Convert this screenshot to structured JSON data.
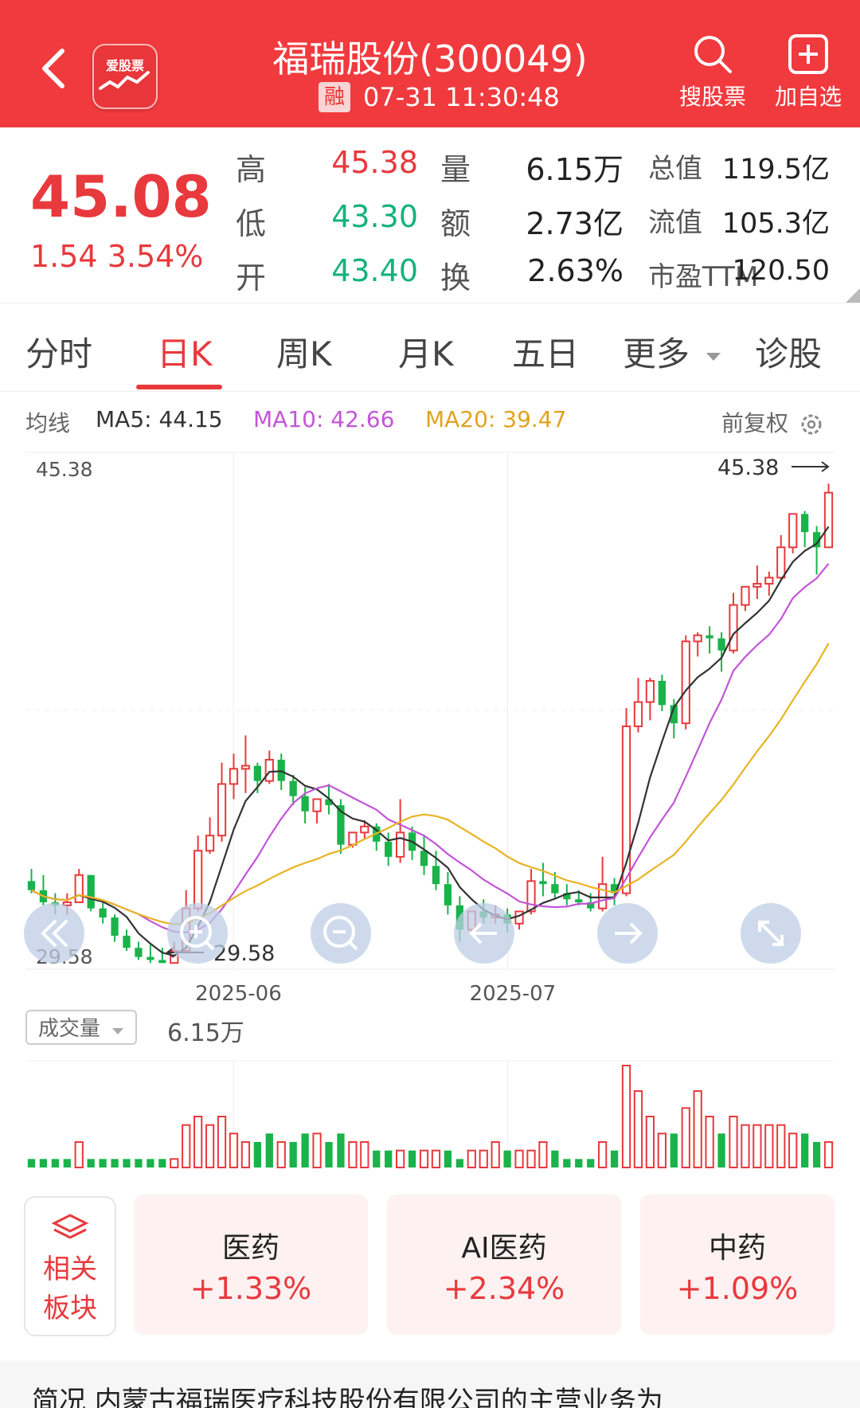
{
  "header": {
    "logo_text": "爱股票",
    "title": "福瑞股份(300049)",
    "badge": "融",
    "datetime": "07-31 11:30:48",
    "search_label": "搜股票",
    "add_label": "加自选"
  },
  "quote": {
    "price": "45.08",
    "change": "1.54 3.54%",
    "rows": [
      {
        "l1": "高",
        "v1": "45.38",
        "c1": "red",
        "l2": "量",
        "v2": "6.15万",
        "l3": "总值",
        "v3": "119.5亿"
      },
      {
        "l1": "低",
        "v1": "43.30",
        "c1": "green",
        "l2": "额",
        "v2": "2.73亿",
        "l3": "流值",
        "v3": "105.3亿"
      },
      {
        "l1": "开",
        "v1": "43.40",
        "c1": "green",
        "l2": "换",
        "v2": "2.63%",
        "l3": "市盈TTM",
        "v3": "120.50"
      }
    ]
  },
  "tabs": [
    "分时",
    "日K",
    "周K",
    "月K",
    "五日",
    "更多",
    "诊股"
  ],
  "active_tab": "日K",
  "ma": {
    "label": "均线",
    "ma5": "MA5: 44.15",
    "ma10": "MA10: 42.66",
    "ma20": "MA20: 39.47",
    "adjust": "前复权"
  },
  "colors": {
    "up": "#e8393d",
    "down": "#19b34a",
    "ma5": "#333333",
    "ma10": "#c355d8",
    "ma20": "#e8b423",
    "header": "#f03a3e"
  },
  "chart_data": {
    "type": "candlestick",
    "x_labels": [
      "2025-06",
      "2025-07"
    ],
    "ylim": [
      29.58,
      45.38
    ],
    "max_label": "45.38",
    "min_label": "29.58",
    "top_left_label": "45.38",
    "bottom_left_label": "29.58",
    "candles": [
      [
        32.3,
        32.7,
        32.0,
        31.9
      ],
      [
        32.0,
        32.5,
        31.6,
        31.5
      ],
      [
        31.6,
        31.9,
        31.5,
        31.2
      ],
      [
        31.5,
        31.9,
        31.6,
        31.2
      ],
      [
        31.6,
        32.7,
        32.5,
        31.6
      ],
      [
        32.5,
        32.5,
        31.4,
        31.3
      ],
      [
        31.4,
        31.6,
        31.1,
        30.9
      ],
      [
        31.1,
        31.2,
        30.5,
        30.3
      ],
      [
        30.5,
        30.7,
        30.1,
        30.0
      ],
      [
        30.1,
        30.3,
        29.8,
        29.7
      ],
      [
        29.8,
        30.2,
        29.7,
        29.6
      ],
      [
        29.7,
        30.1,
        29.6,
        29.6
      ],
      [
        29.6,
        30.3,
        30.0,
        29.6
      ],
      [
        30.0,
        32.0,
        31.4,
        30.0
      ],
      [
        31.4,
        33.8,
        33.3,
        31.3
      ],
      [
        33.3,
        34.4,
        33.8,
        33.2
      ],
      [
        33.8,
        36.2,
        35.5,
        33.6
      ],
      [
        35.5,
        36.5,
        36.0,
        35.0
      ],
      [
        36.0,
        37.1,
        36.1,
        35.2
      ],
      [
        36.1,
        36.2,
        35.6,
        35.2
      ],
      [
        35.6,
        36.6,
        36.3,
        35.5
      ],
      [
        36.3,
        36.5,
        35.6,
        35.3
      ],
      [
        35.6,
        35.8,
        35.1,
        34.8
      ],
      [
        35.1,
        35.4,
        34.6,
        34.2
      ],
      [
        34.6,
        34.9,
        35.0,
        34.2
      ],
      [
        35.0,
        35.5,
        34.8,
        34.5
      ],
      [
        34.8,
        35.0,
        33.5,
        33.2
      ],
      [
        33.5,
        33.9,
        33.9,
        33.4
      ],
      [
        33.9,
        34.3,
        34.1,
        33.7
      ],
      [
        34.1,
        34.2,
        33.6,
        33.3
      ],
      [
        33.6,
        33.9,
        33.1,
        32.8
      ],
      [
        33.1,
        35.0,
        33.9,
        32.9
      ],
      [
        33.9,
        34.1,
        33.3,
        33.0
      ],
      [
        33.3,
        33.8,
        32.8,
        32.5
      ],
      [
        32.8,
        33.3,
        32.2,
        32.0
      ],
      [
        32.2,
        32.6,
        31.5,
        31.2
      ],
      [
        31.5,
        31.8,
        30.7,
        30.3
      ],
      [
        30.7,
        30.9,
        31.3,
        30.5
      ],
      [
        31.3,
        31.7,
        31.1,
        30.9
      ],
      [
        31.1,
        31.5,
        31.2,
        30.9
      ],
      [
        31.2,
        31.4,
        30.9,
        30.6
      ],
      [
        30.9,
        31.3,
        31.3,
        30.7
      ],
      [
        31.3,
        32.7,
        32.3,
        31.2
      ],
      [
        32.3,
        32.9,
        32.2,
        31.8
      ],
      [
        32.2,
        32.6,
        31.9,
        31.7
      ],
      [
        31.9,
        32.2,
        31.7,
        31.5
      ],
      [
        31.7,
        32.0,
        31.6,
        31.5
      ],
      [
        31.6,
        31.9,
        31.4,
        31.3
      ],
      [
        31.4,
        33.1,
        32.2,
        31.3
      ],
      [
        32.2,
        32.4,
        31.9,
        31.5
      ],
      [
        31.9,
        38.0,
        37.4,
        31.8
      ],
      [
        37.4,
        39.0,
        38.2,
        37.2
      ],
      [
        38.2,
        39.0,
        38.9,
        37.6
      ],
      [
        38.9,
        39.1,
        38.1,
        37.9
      ],
      [
        38.1,
        38.3,
        37.5,
        37.0
      ],
      [
        37.5,
        40.4,
        40.2,
        37.3
      ],
      [
        40.2,
        40.5,
        40.4,
        39.7
      ],
      [
        40.4,
        40.7,
        40.3,
        39.8
      ],
      [
        40.3,
        40.5,
        39.9,
        39.2
      ],
      [
        39.9,
        41.8,
        41.4,
        39.8
      ],
      [
        41.4,
        41.6,
        42.0,
        41.2
      ],
      [
        42.0,
        42.7,
        42.1,
        41.6
      ],
      [
        42.1,
        42.5,
        42.3,
        41.7
      ],
      [
        42.3,
        43.7,
        43.3,
        42.2
      ],
      [
        43.3,
        44.4,
        44.4,
        43.1
      ],
      [
        44.4,
        44.5,
        43.8,
        43.3
      ],
      [
        43.8,
        44.0,
        43.3,
        42.4
      ],
      [
        43.3,
        45.4,
        45.1,
        43.3
      ]
    ],
    "volume_label": "成交量",
    "volume_value": "6.15万",
    "volume": [
      [
        1,
        0
      ],
      [
        1,
        0
      ],
      [
        1,
        0
      ],
      [
        1,
        0
      ],
      [
        3,
        1
      ],
      [
        1,
        0
      ],
      [
        1,
        0
      ],
      [
        1,
        0
      ],
      [
        1,
        0
      ],
      [
        1,
        0
      ],
      [
        1,
        0
      ],
      [
        1,
        0
      ],
      [
        1,
        1
      ],
      [
        5,
        1
      ],
      [
        6,
        1
      ],
      [
        5,
        1
      ],
      [
        6,
        1
      ],
      [
        4,
        1
      ],
      [
        3,
        1
      ],
      [
        3,
        0
      ],
      [
        4,
        0
      ],
      [
        3,
        1
      ],
      [
        3,
        0
      ],
      [
        4,
        0
      ],
      [
        4,
        1
      ],
      [
        3,
        0
      ],
      [
        4,
        0
      ],
      [
        3,
        1
      ],
      [
        3,
        1
      ],
      [
        2,
        0
      ],
      [
        2,
        0
      ],
      [
        2,
        1
      ],
      [
        2,
        0
      ],
      [
        2,
        1
      ],
      [
        2,
        1
      ],
      [
        2,
        0
      ],
      [
        1,
        0
      ],
      [
        2,
        1
      ],
      [
        2,
        1
      ],
      [
        3,
        1
      ],
      [
        2,
        0
      ],
      [
        2,
        1
      ],
      [
        2,
        1
      ],
      [
        3,
        1
      ],
      [
        2,
        0
      ],
      [
        1,
        0
      ],
      [
        1,
        0
      ],
      [
        1,
        0
      ],
      [
        3,
        1
      ],
      [
        2,
        0
      ],
      [
        12,
        1
      ],
      [
        9,
        1
      ],
      [
        6,
        1
      ],
      [
        4,
        1
      ],
      [
        4,
        0
      ],
      [
        7,
        1
      ],
      [
        9,
        1
      ],
      [
        6,
        1
      ],
      [
        4,
        0
      ],
      [
        6,
        1
      ],
      [
        5,
        1
      ],
      [
        5,
        1
      ],
      [
        5,
        1
      ],
      [
        5,
        1
      ],
      [
        4,
        1
      ],
      [
        4,
        0
      ],
      [
        3,
        0
      ],
      [
        3,
        1
      ]
    ]
  },
  "chart_controls": {
    "prev_icon": "double-left-icon",
    "zoom_in_icon": "zoom-in-icon",
    "zoom_out_icon": "zoom-out-icon",
    "left_icon": "arrow-left-icon",
    "right_icon": "arrow-right-icon",
    "fullscreen_icon": "fullscreen-icon"
  },
  "related": {
    "label_line1": "相关",
    "label_line2": "板块",
    "cards": [
      {
        "name": "医药",
        "pct": "+1.33%"
      },
      {
        "name": "AI医药",
        "pct": "+2.34%"
      },
      {
        "name": "中药",
        "pct": "+1.09%"
      }
    ]
  },
  "footer": {
    "text": "简况 内蒙古福瑞医疗科技股份有限公司的主营业务为"
  }
}
